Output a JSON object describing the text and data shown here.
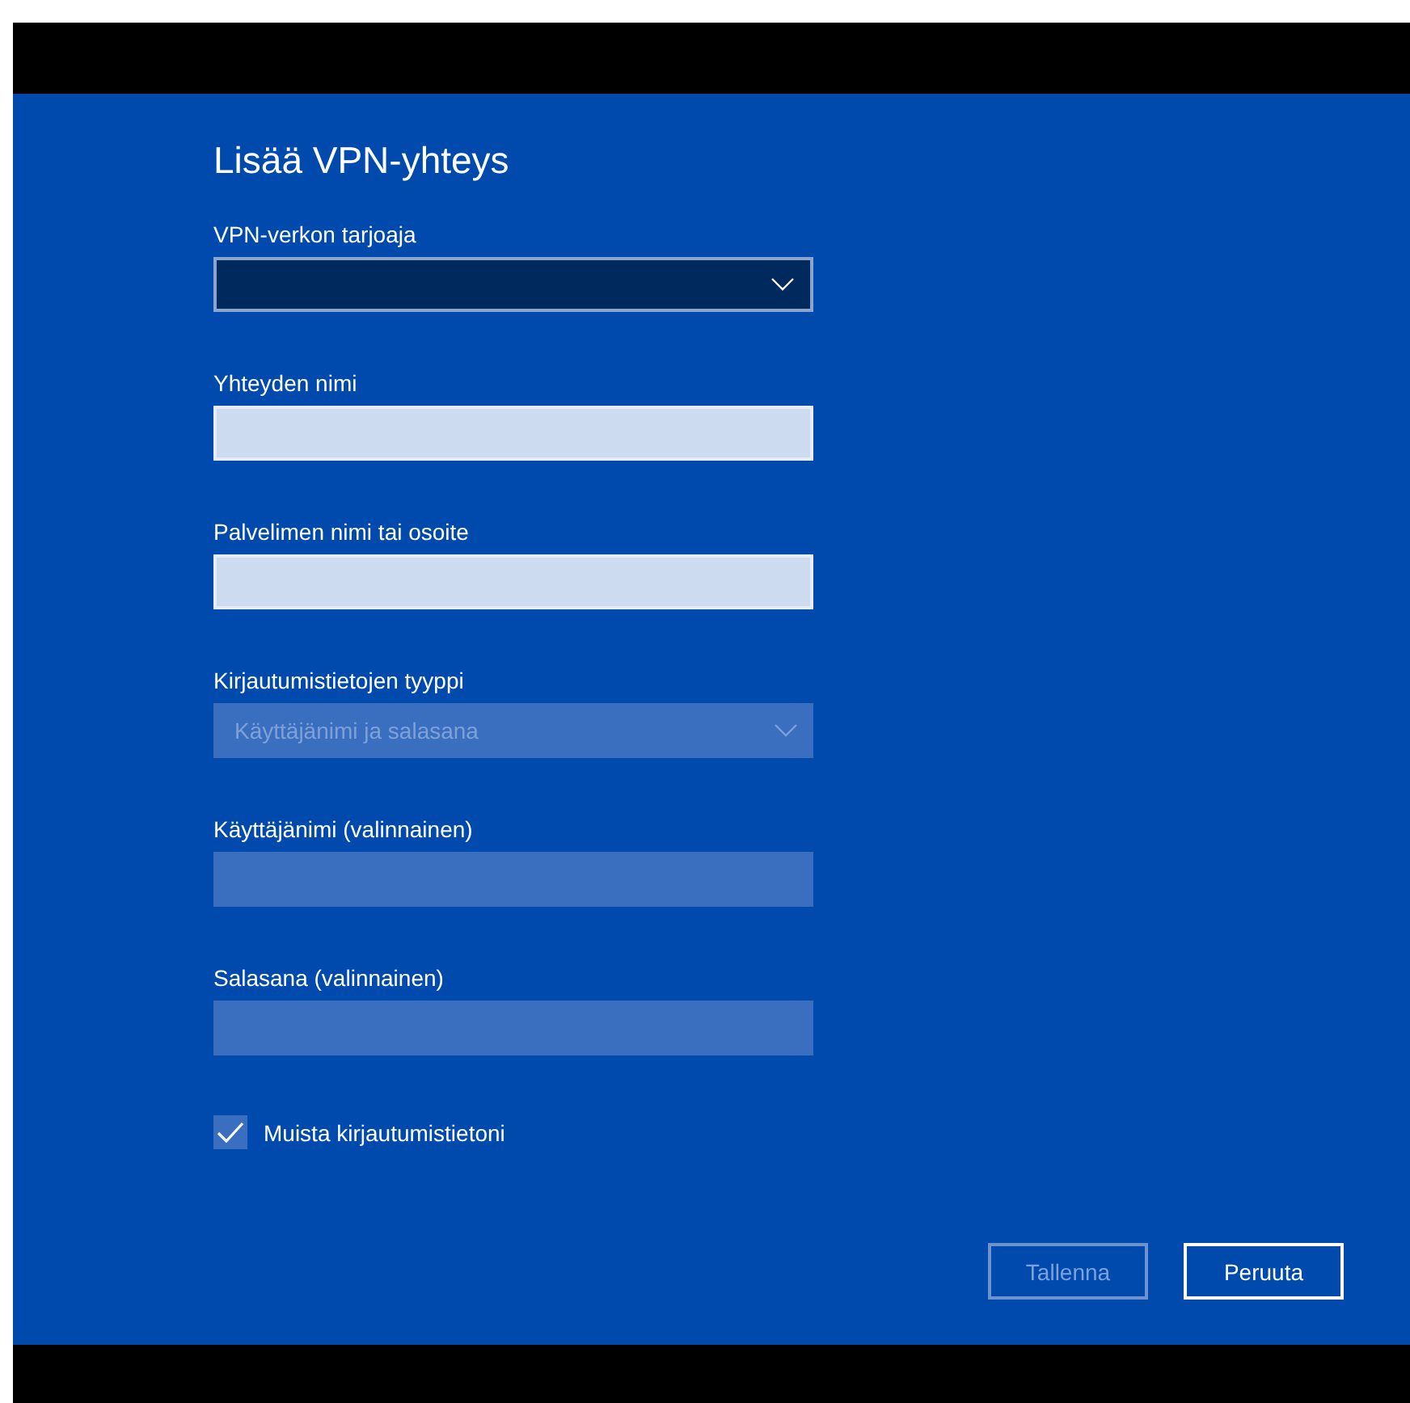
{
  "title": "Lisää VPN-yhteys",
  "fields": [
    {
      "kind": "dropdown",
      "label": "VPN-verkon tarjoaja",
      "disabled": false
    },
    {
      "kind": "text",
      "label": "Yhteyden nimi",
      "disabled": false
    },
    {
      "kind": "text",
      "label": "Palvelimen nimi tai osoite",
      "disabled": false
    },
    {
      "kind": "dropdown",
      "label": "Kirjautumistietojen tyyppi",
      "value": "Käyttäjänimi ja salasana",
      "disabled": true
    },
    {
      "kind": "text",
      "label": "Käyttäjänimi (valinnainen)",
      "disabled": true
    },
    {
      "kind": "text",
      "label": "Salasana (valinnainen)",
      "disabled": true
    }
  ],
  "remember": {
    "label": "Muista kirjautumistietoni",
    "checked": true
  },
  "buttons": [
    {
      "label": "Tallenna",
      "disabled": true
    },
    {
      "label": "Peruuta",
      "disabled": false
    }
  ]
}
